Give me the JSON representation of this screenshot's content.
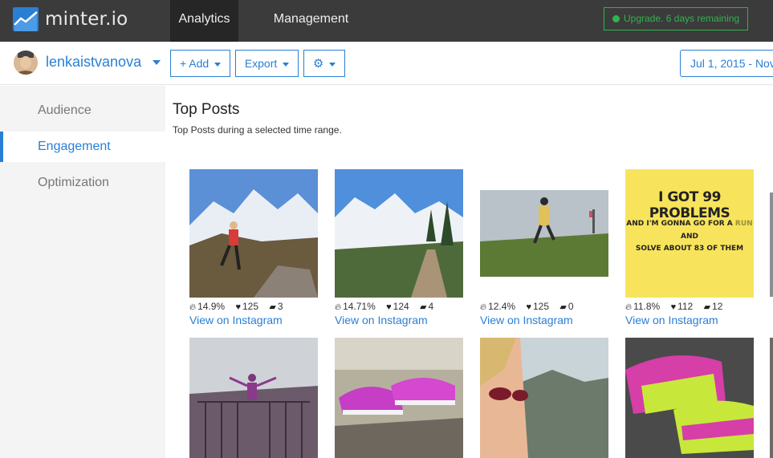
{
  "topbar": {
    "brand": "minter.io",
    "tabs": [
      {
        "label": "Analytics"
      },
      {
        "label": "Management"
      }
    ],
    "upgrade_label": "Upgrade. 6 days remaining"
  },
  "subbar": {
    "username": "lenkaistvanova",
    "add_label": "+ Add",
    "export_label": "Export",
    "date_range": "Jul 1, 2015 - Nov"
  },
  "sidebar": {
    "items": [
      {
        "label": "Audience"
      },
      {
        "label": "Engagement"
      },
      {
        "label": "Optimization"
      }
    ]
  },
  "main": {
    "title": "Top Posts",
    "subtitle": "Top Posts during a selected time range.",
    "link_label": "View on Instagram",
    "posts": [
      {
        "engagement": "14.9%",
        "likes": "125",
        "comments": "3"
      },
      {
        "engagement": "14.71%",
        "likes": "124",
        "comments": "4"
      },
      {
        "engagement": "12.4%",
        "likes": "125",
        "comments": "0"
      },
      {
        "engagement": "11.8%",
        "likes": "112",
        "comments": "12"
      }
    ],
    "poster_text": {
      "line1": "I GOT 99 PROBLEMS",
      "line2a": "AND I'M GONNA GO FOR A ",
      "line2b": "RUN",
      "line3": "AND",
      "line4": "SOLVE ABOUT 83 OF THEM"
    }
  },
  "colors": {
    "accent": "#2a7fd4",
    "topbar": "#3b3b3b",
    "upgrade_green": "#2fb34b",
    "poster_yellow": "#f8e45c"
  }
}
